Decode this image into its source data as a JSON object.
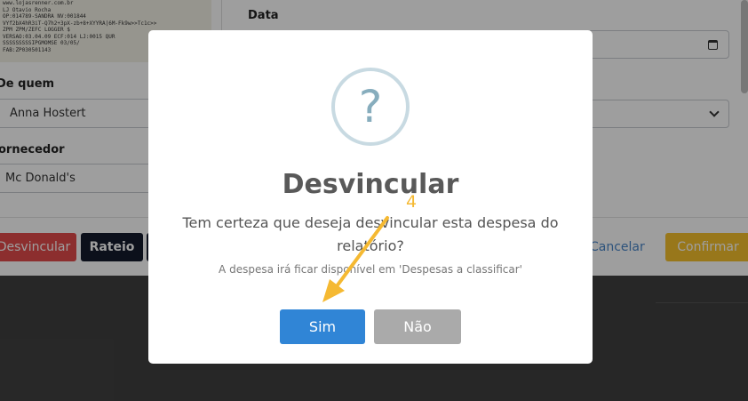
{
  "receipt": {
    "lines": [
      "www.lojasrenner.com.br",
      "LJ Otavio Rocha",
      "OP:014789-SANDRA NV:001844",
      "VYf2bX4hR3iT-Q7h2+3pX-zb+8+XYYRA|6M-Fk9w>>Tc1c>>",
      "ZPM           ZPM/ZEFC LOGGER       $",
      "VERSAO:03.04.09 ECF:014 LJ:0015 QUR",
      "SSSSSSSSSIPGMOMSE        03/05/",
      "FAB:ZP030501143"
    ]
  },
  "form": {
    "date_label": "Data",
    "from_label": "De quem",
    "from_value": "Anna Hostert",
    "supplier_label": "ornecedor",
    "supplier_value": "Mc Donald's"
  },
  "footer": {
    "unlink_button": "Desvincular",
    "split_button": "Rateio",
    "cancel_link": "Cancelar",
    "confirm_button": "Confirmar"
  },
  "modal": {
    "icon_glyph": "?",
    "title": "Desvincular",
    "message": "Tem certeza que deseja desvincular esta despesa do relatório?",
    "subtext": "A despesa irá ficar disponível em 'Despesas a classificar'",
    "yes_button": "Sim",
    "no_button": "Não"
  },
  "annotation": {
    "step_number": "4",
    "color": "#f5b932"
  },
  "colors": {
    "primary": "#3085d6",
    "danger": "#e34b4b",
    "warning": "#f5c02c",
    "dark": "#141a2c"
  }
}
